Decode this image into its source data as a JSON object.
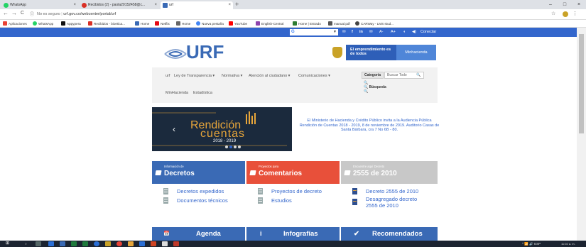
{
  "browser": {
    "tabs": [
      {
        "label": "WhatsApp",
        "color": "#25d366"
      },
      {
        "label": "Recibidos (2) - paola20152458@c...",
        "color": "#d93025"
      },
      {
        "label": "urf",
        "color": "#3a6ab5"
      }
    ],
    "new_tab": "+",
    "window_controls": [
      "–",
      "□",
      "×"
    ],
    "nav": {
      "back": "←",
      "forward": "→",
      "reload": "C",
      "security": "ⓘ",
      "security_label": "No es seguro",
      "url": "urf.gov.co/webcenter/portal/urf"
    },
    "star": "☆",
    "bookmarks": [
      {
        "label": "Aplicaciones",
        "color": "#e94235"
      },
      {
        "label": "WhatsApp",
        "color": "#25d366"
      },
      {
        "label": "Appypera",
        "color": "#111111"
      },
      {
        "label": "Recibidos - bioetica...",
        "color": "#d93025"
      },
      {
        "label": "Home",
        "color": "#3a6ab5"
      },
      {
        "label": "Netflix",
        "color": "#e50914"
      },
      {
        "label": "Home",
        "color": "#666666"
      },
      {
        "label": "Nueva pestaña",
        "color": "#4285f4"
      },
      {
        "label": "YouTube",
        "color": "#ff0000"
      },
      {
        "label": "English-Central",
        "color": "#8e44ad"
      },
      {
        "label": "Home | Estrado",
        "color": "#2e7d32"
      },
      {
        "label": "manual.pdf",
        "color": "#555555"
      },
      {
        "label": "CARWay - LMS stud...",
        "color": "#444444"
      }
    ]
  },
  "govbar": {
    "search_logo": "G",
    "search_dropdown": "▼",
    "icons": [
      "✉",
      "f",
      "in",
      "✉",
      "A-",
      "A+",
      "◐",
      "◀)"
    ],
    "connect_label": "Conectar"
  },
  "header": {
    "logo_text": "URF",
    "emprendimiento": "El emprendimiento es de todos",
    "minhacienda": "Minhacienda"
  },
  "nav": {
    "items": [
      "urf",
      "Ley de Transparencia ▾",
      "Normativa ▾",
      "Atención al ciudadano ▾",
      "Comunicaciones ▾"
    ],
    "second_row": [
      "MinHacienda",
      "Estadística"
    ],
    "category_button": "Categoría",
    "search_placeholder": "Buscar Todo",
    "search_icon": "🔍",
    "dropdown_items": [
      "",
      "Búsqueda",
      ""
    ]
  },
  "banner": {
    "title_1": "Rendición",
    "title_2": "cuentas",
    "years": "2018 - 2019",
    "prev": "‹"
  },
  "announcement": {
    "text": "El Ministerio de Hacienda y Crédito Público invita a la Audiencia Pública Rendición de Cuentas 2018 - 2019, 8 de noviembre de 2019. Auditorio Casas de Santa Bárbara, cra 7 No 6B - 80."
  },
  "cards": [
    {
      "small": "Información de",
      "big": "Decretos",
      "color": "#3a6ab5",
      "links": [
        "Decretos expedidos",
        "Documentos técnicos"
      ]
    },
    {
      "small": "Proyectos para",
      "big": "Comentarios",
      "color": "#e8503a",
      "links": [
        "Proyectos de decreto",
        "Estudios"
      ]
    },
    {
      "small": "Encuentre aquí Decreto",
      "big": "2555 de 2010",
      "color": "#c8c8c8",
      "links": [
        "Decreto 2555 de 2010",
        "Desagregado decreto 2555 de 2010"
      ]
    }
  ],
  "bottom_cards": [
    {
      "icon": "📅",
      "label": "Agenda"
    },
    {
      "icon": "i",
      "label": "Infografías"
    },
    {
      "icon": "✔",
      "label": "Recomendados"
    }
  ],
  "taskbar": {
    "start": "⊞",
    "search": "○",
    "tray_text": "^ 📶 🔊 ESP",
    "time": "11:02 a. m."
  }
}
